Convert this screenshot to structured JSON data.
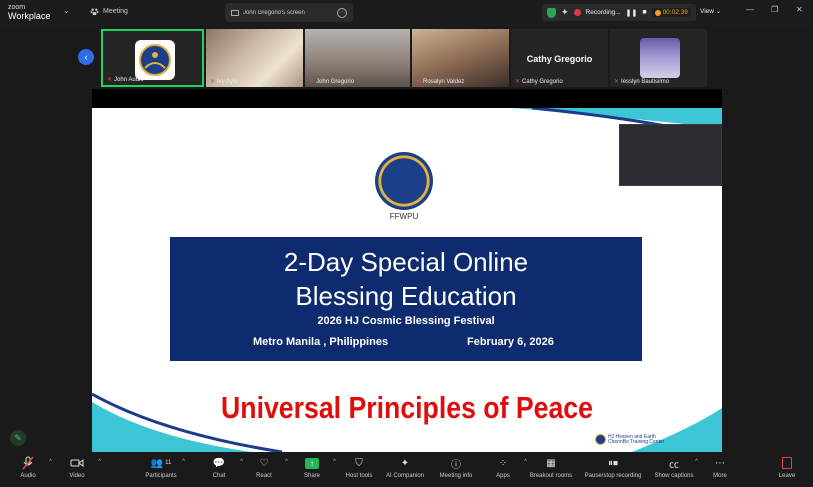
{
  "app": {
    "brand_top": "zoom",
    "brand_bottom": "Workplace",
    "meeting_tab": "Meeting"
  },
  "screen_tab": {
    "label": "John Gregorio's screen"
  },
  "recording": {
    "status": "Recording...",
    "timer": "00:02:39",
    "view_label": "View"
  },
  "participants": [
    {
      "name": "John Audio"
    },
    {
      "name": "Ivy Ayis"
    },
    {
      "name": "John Gregorio"
    },
    {
      "name": "Rosalyn Valdez"
    },
    {
      "name": "Cathy Gregorio",
      "display": "Cathy Gregorio"
    },
    {
      "name": "Iesslyn Bautisilmo"
    }
  ],
  "slide": {
    "logo_text": "FFWPU",
    "title_line1": "2-Day Special Online",
    "title_line2": "Blessing Education",
    "subtitle": "2026 HJ Cosmic Blessing Festival",
    "location": "Metro Manila , Philippines",
    "date": "February 6, 2026",
    "headline": "Universal Principles of Peace",
    "corner_line1": "HJ Heaven and Earth",
    "corner_line2": "CheonBo Training Center"
  },
  "toolbar": {
    "audio": "Audio",
    "video": "Video",
    "participants": "Participants",
    "participants_count": "11",
    "chat": "Chat",
    "react": "React",
    "share": "Share",
    "host_tools": "Host tools",
    "ai_companion": "AI Companion",
    "meeting_info": "Meeting info",
    "apps": "Apps",
    "breakout": "Breakout rooms",
    "pause_rec": "Pause/stop recording",
    "captions": "Show captions",
    "more": "More",
    "leave": "Leave"
  },
  "colors": {
    "accent_blue": "#2d6ee8",
    "active_green": "#23d160",
    "banner_navy": "#0d2b6e",
    "headline_red": "#e00d0d",
    "share_green": "#23b55a"
  }
}
